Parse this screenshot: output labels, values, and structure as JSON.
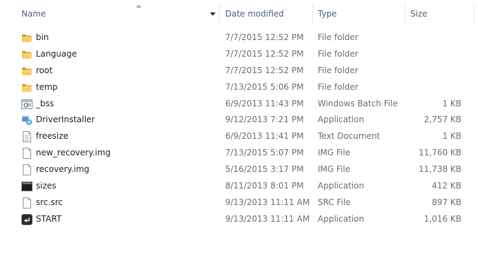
{
  "columns": {
    "name": "Name",
    "date": "Date modified",
    "type": "Type",
    "size": "Size"
  },
  "files": [
    {
      "name": "bin",
      "date": "7/7/2015 12:52 PM",
      "type": "File folder",
      "size": "",
      "icon": "folder-icon"
    },
    {
      "name": "Language",
      "date": "7/7/2015 12:52 PM",
      "type": "File folder",
      "size": "",
      "icon": "folder-icon"
    },
    {
      "name": "root",
      "date": "7/7/2015 12:52 PM",
      "type": "File folder",
      "size": "",
      "icon": "folder-icon"
    },
    {
      "name": "temp",
      "date": "7/13/2015 5:06 PM",
      "type": "File folder",
      "size": "",
      "icon": "folder-icon"
    },
    {
      "name": "_bss",
      "date": "6/9/2013 11:43 PM",
      "type": "Windows Batch File",
      "size": "1 KB",
      "icon": "batch-file-icon"
    },
    {
      "name": "DriverInstaller",
      "date": "9/12/2013 7:21 PM",
      "type": "Application",
      "size": "2,757 KB",
      "icon": "installer-app-icon"
    },
    {
      "name": "freesize",
      "date": "6/9/2013 11:41 PM",
      "type": "Text Document",
      "size": "1 KB",
      "icon": "text-document-icon"
    },
    {
      "name": "new_recovery.img",
      "date": "7/13/2015 5:07 PM",
      "type": "IMG File",
      "size": "11,760 KB",
      "icon": "blank-file-icon"
    },
    {
      "name": "recovery.img",
      "date": "5/16/2015 3:17 PM",
      "type": "IMG File",
      "size": "11,738 KB",
      "icon": "blank-file-icon"
    },
    {
      "name": "sizes",
      "date": "8/11/2013 8:01 PM",
      "type": "Application",
      "size": "412 KB",
      "icon": "console-app-icon"
    },
    {
      "name": "src.src",
      "date": "9/13/2013 11:11 AM",
      "type": "SRC File",
      "size": "897 KB",
      "icon": "blank-file-icon"
    },
    {
      "name": "START",
      "date": "9/13/2013 11:11 AM",
      "type": "Application",
      "size": "1,016 KB",
      "icon": "terminal-app-icon"
    }
  ]
}
